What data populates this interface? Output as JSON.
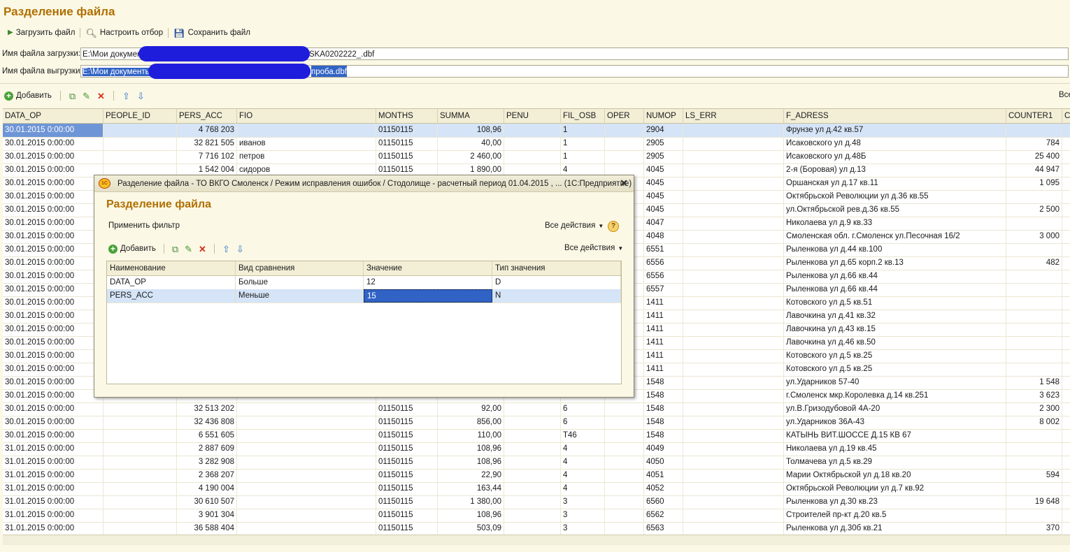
{
  "window": {
    "title": "Разделение файла"
  },
  "toolbar": {
    "load": "Загрузить файл",
    "filter": "Настроить отбор",
    "save": "Сохранить файл"
  },
  "fields": {
    "upload_label": "Имя файла загрузки:",
    "upload_prefix": "E:\\Мои документы",
    "upload_suffix": "SKA0202222_.dbf",
    "download_label": "Имя файла выгрузки:",
    "download_prefix": "E:\\Мои документы",
    "download_suffix": "проба.dbf"
  },
  "table_toolbar": {
    "add": "Добавить",
    "all_actions": "Все"
  },
  "table": {
    "columns": [
      "DATA_OP",
      "PEOPLE_ID",
      "PERS_ACC",
      "FIO",
      "MONTHS",
      "SUMMA",
      "PENU",
      "FIL_OSB",
      "OPER",
      "NUMOP",
      "LS_ERR",
      "F_ADRESS",
      "COUNTER1",
      "C"
    ],
    "rows": [
      [
        "30.01.2015 0:00:00",
        "",
        "4 768 203",
        "",
        "01150115",
        "108,96",
        "",
        "1",
        "",
        "2904",
        "",
        "Фрунзе ул д.42 кв.57",
        ""
      ],
      [
        "30.01.2015 0:00:00",
        "",
        "32 821 505",
        "иванов",
        "01150115",
        "40,00",
        "",
        "1",
        "",
        "2905",
        "",
        "Исаковского ул д.48",
        "784"
      ],
      [
        "30.01.2015 0:00:00",
        "",
        "7 716 102",
        "петров",
        "01150115",
        "2 460,00",
        "",
        "1",
        "",
        "2905",
        "",
        "Исаковского ул д.48Б",
        "25 400"
      ],
      [
        "30.01.2015 0:00:00",
        "",
        "1 542 004",
        "сидоров",
        "01150115",
        "1 890,00",
        "",
        "4",
        "",
        "4045",
        "",
        "2-я (Боровая) ул д.13",
        "44 947"
      ],
      [
        "30.01.2015 0:00:00",
        "",
        "",
        "",
        "",
        "",
        "",
        "",
        "",
        "4045",
        "",
        "Оршанская ул д.17 кв.11",
        "1 095"
      ],
      [
        "30.01.2015 0:00:00",
        "",
        "",
        "",
        "",
        "",
        "",
        "",
        "",
        "4045",
        "",
        "Октябрьской Революции ул д.36 кв.55",
        ""
      ],
      [
        "30.01.2015 0:00:00",
        "",
        "",
        "",
        "",
        "",
        "",
        "",
        "",
        "4045",
        "",
        "ул.Октябрьской рев.д.36 кв.55",
        "2 500"
      ],
      [
        "30.01.2015 0:00:00",
        "",
        "",
        "",
        "",
        "",
        "",
        "",
        "",
        "4047",
        "",
        "Николаева ул д.9 кв.33",
        ""
      ],
      [
        "30.01.2015 0:00:00",
        "",
        "",
        "",
        "",
        "",
        "",
        "",
        "",
        "4048",
        "",
        "Смоленская обл. г.Смоленск ул.Песочная  16/2",
        "3 000"
      ],
      [
        "30.01.2015 0:00:00",
        "",
        "",
        "",
        "",
        "",
        "",
        "",
        "",
        "6551",
        "",
        "Рыленкова ул д.44 кв.100",
        ""
      ],
      [
        "30.01.2015 0:00:00",
        "",
        "",
        "",
        "",
        "",
        "",
        "",
        "",
        "6556",
        "",
        "Рыленкова ул д.65 корп.2 кв.13",
        "482"
      ],
      [
        "30.01.2015 0:00:00",
        "",
        "",
        "",
        "",
        "",
        "",
        "",
        "",
        "6556",
        "",
        "Рыленкова ул д.66 кв.44",
        ""
      ],
      [
        "30.01.2015 0:00:00",
        "",
        "",
        "",
        "",
        "",
        "",
        "",
        "",
        "6557",
        "",
        "Рыленкова ул д.66 кв.44",
        ""
      ],
      [
        "30.01.2015 0:00:00",
        "",
        "",
        "",
        "",
        "",
        "",
        "",
        "",
        "1411",
        "",
        "Котовского ул д.5 кв.51",
        ""
      ],
      [
        "30.01.2015 0:00:00",
        "",
        "",
        "",
        "",
        "",
        "",
        "",
        "",
        "1411",
        "",
        "Лавочкина ул д.41 кв.32",
        ""
      ],
      [
        "30.01.2015 0:00:00",
        "",
        "",
        "",
        "",
        "",
        "",
        "",
        "",
        "1411",
        "",
        "Лавочкина ул д.43 кв.15",
        ""
      ],
      [
        "30.01.2015 0:00:00",
        "",
        "",
        "",
        "",
        "",
        "",
        "",
        "",
        "1411",
        "",
        "Лавочкина ул д.46 кв.50",
        ""
      ],
      [
        "30.01.2015 0:00:00",
        "",
        "",
        "",
        "",
        "",
        "",
        "",
        "",
        "1411",
        "",
        "Котовского ул д.5 кв.25",
        ""
      ],
      [
        "30.01.2015 0:00:00",
        "",
        "",
        "",
        "",
        "",
        "",
        "",
        "",
        "1411",
        "",
        "Котовского ул д.5 кв.25",
        ""
      ],
      [
        "30.01.2015 0:00:00",
        "",
        "",
        "",
        "",
        "",
        "",
        "",
        "",
        "1548",
        "",
        "ул.Ударников 57-40",
        "1 548"
      ],
      [
        "30.01.2015 0:00:00",
        "",
        "",
        "",
        "",
        "",
        "",
        "",
        "",
        "1548",
        "",
        "г.Смоленск мкр.Королевка д.14 кв.251",
        "3 623"
      ],
      [
        "30.01.2015 0:00:00",
        "",
        "32 513 202",
        "",
        "01150115",
        "92,00",
        "",
        "6",
        "",
        "1548",
        "",
        "ул.В.Гризодубовой 4А-20",
        "2 300"
      ],
      [
        "30.01.2015 0:00:00",
        "",
        "32 436 808",
        "",
        "01150115",
        "856,00",
        "",
        "6",
        "",
        "1548",
        "",
        "ул.Ударников 36А-43",
        "8 002"
      ],
      [
        "30.01.2015 0:00:00",
        "",
        "6 551 605",
        "",
        "01150115",
        "110,00",
        "",
        "Т46",
        "",
        "1548",
        "",
        "КАТЫНЬ ВИТ.ШОССЕ Д.15 КВ 67",
        ""
      ],
      [
        "31.01.2015 0:00:00",
        "",
        "2 887 609",
        "",
        "01150115",
        "108,96",
        "",
        "4",
        "",
        "4049",
        "",
        "Николаева ул д.19 кв.45",
        ""
      ],
      [
        "31.01.2015 0:00:00",
        "",
        "3 282 908",
        "",
        "01150115",
        "108,96",
        "",
        "4",
        "",
        "4050",
        "",
        "Толмачева ул д.5 кв.29",
        ""
      ],
      [
        "31.01.2015 0:00:00",
        "",
        "2 368 207",
        "",
        "01150115",
        "22,90",
        "",
        "4",
        "",
        "4051",
        "",
        "Марии Октябрьской ул д.18 кв.20",
        "594"
      ],
      [
        "31.01.2015 0:00:00",
        "",
        "4 190 004",
        "",
        "01150115",
        "163,44",
        "",
        "4",
        "",
        "4052",
        "",
        "Октябрьской Революции ул д.7 кв.92",
        ""
      ],
      [
        "31.01.2015 0:00:00",
        "",
        "30 610 507",
        "",
        "01150115",
        "1 380,00",
        "",
        "3",
        "",
        "6560",
        "",
        "Рыленкова ул д.30 кв.23",
        "19 648"
      ],
      [
        "31.01.2015 0:00:00",
        "",
        "3 901 304",
        "",
        "01150115",
        "108,96",
        "",
        "3",
        "",
        "6562",
        "",
        "Строителей пр-кт д.20 кв.5",
        ""
      ],
      [
        "31.01.2015 0:00:00",
        "",
        "36 588 404",
        "",
        "01150115",
        "503,09",
        "",
        "3",
        "",
        "6563",
        "",
        "Рыленкова ул д.30б кв.21",
        "370"
      ]
    ]
  },
  "dialog": {
    "window_title": "Разделение файла - ТО ВКГО Смоленск / Режим исправления ошибок / Стодолище - расчетный период 01.04.2015 , ...  (1С:Предприятие)",
    "logo_text": "1С",
    "title": "Разделение файла",
    "apply_filter": "Применить фильтр",
    "all_actions": "Все действия",
    "add": "Добавить",
    "columns": [
      "Наименование",
      "Вид сравнения",
      "Значение",
      "Тип значения"
    ],
    "rows": [
      [
        "DATA_OP",
        "Больше",
        "12",
        "D"
      ],
      [
        "PERS_ACC",
        "Меньше",
        "15",
        "N"
      ]
    ]
  },
  "colors": {
    "title": "#b06f00",
    "selection": "#3163c6",
    "selected_row": "#d5e4f7",
    "background": "#fbf8e6"
  }
}
